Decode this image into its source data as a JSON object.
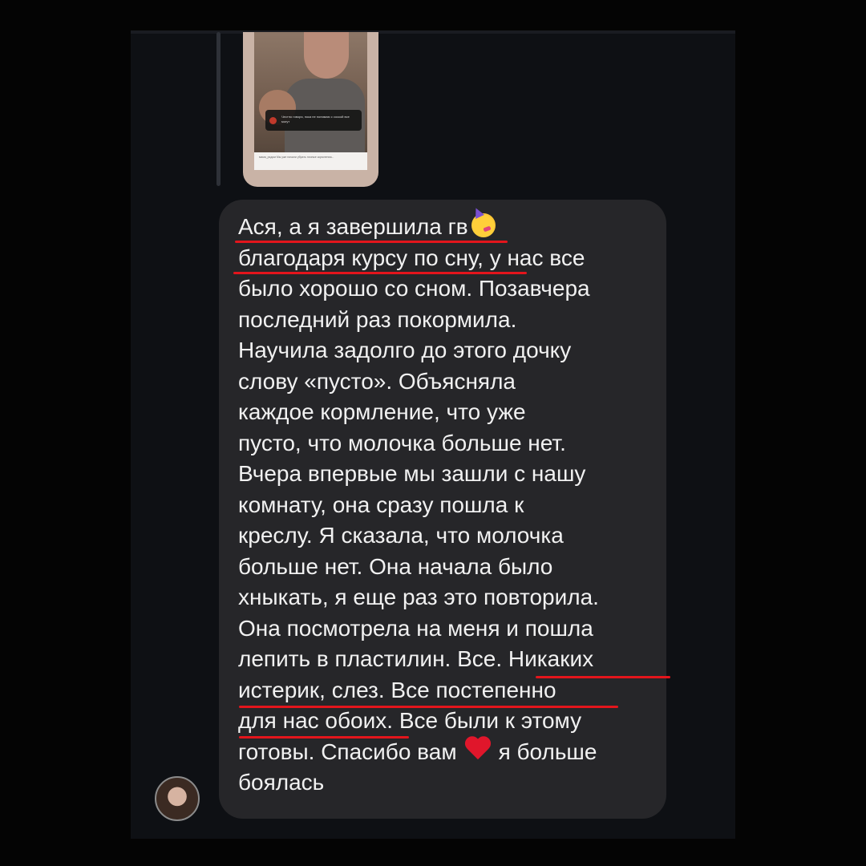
{
  "story_reply": {
    "sticker_text": "Честно говоря, пока не понимаю с соской все могут",
    "caption_text": "мама_рядом Мы уже начали убрать ночные кормления..."
  },
  "message": {
    "lines": [
      "Ася, а я завершила гв",
      "благодаря курсу по сну, у нас все",
      "было хорошо со сном. Позавчера",
      "последний раз покормила.",
      "Научила задолго до этого дочку",
      "слову «пусто». Объясняла",
      "каждое кормление, что уже",
      "пусто, что молочка больше нет.",
      "Вчера впервые мы зашли с нашу",
      "комнату, она сразу пошла к",
      "креслу. Я сказала, что молочка",
      "больше нет. Она начала было",
      "хныкать, я еще раз это повторила.",
      "Она посмотрела на меня и пошла",
      "лепить в пластилин. Все. Никаких",
      "истерик, слез. Все постепенно",
      "для нас обоих. Все были к этому",
      "готовы. Спасибо вам",
      "я больше",
      "боялась"
    ],
    "emoji_party": "partying-face-emoji",
    "emoji_heart": "red-heart-emoji"
  },
  "colors": {
    "background": "#040404",
    "chat_background": "#0e1014",
    "bubble": "#262629",
    "text": "#f1f1f1",
    "underline": "#e3151c"
  }
}
